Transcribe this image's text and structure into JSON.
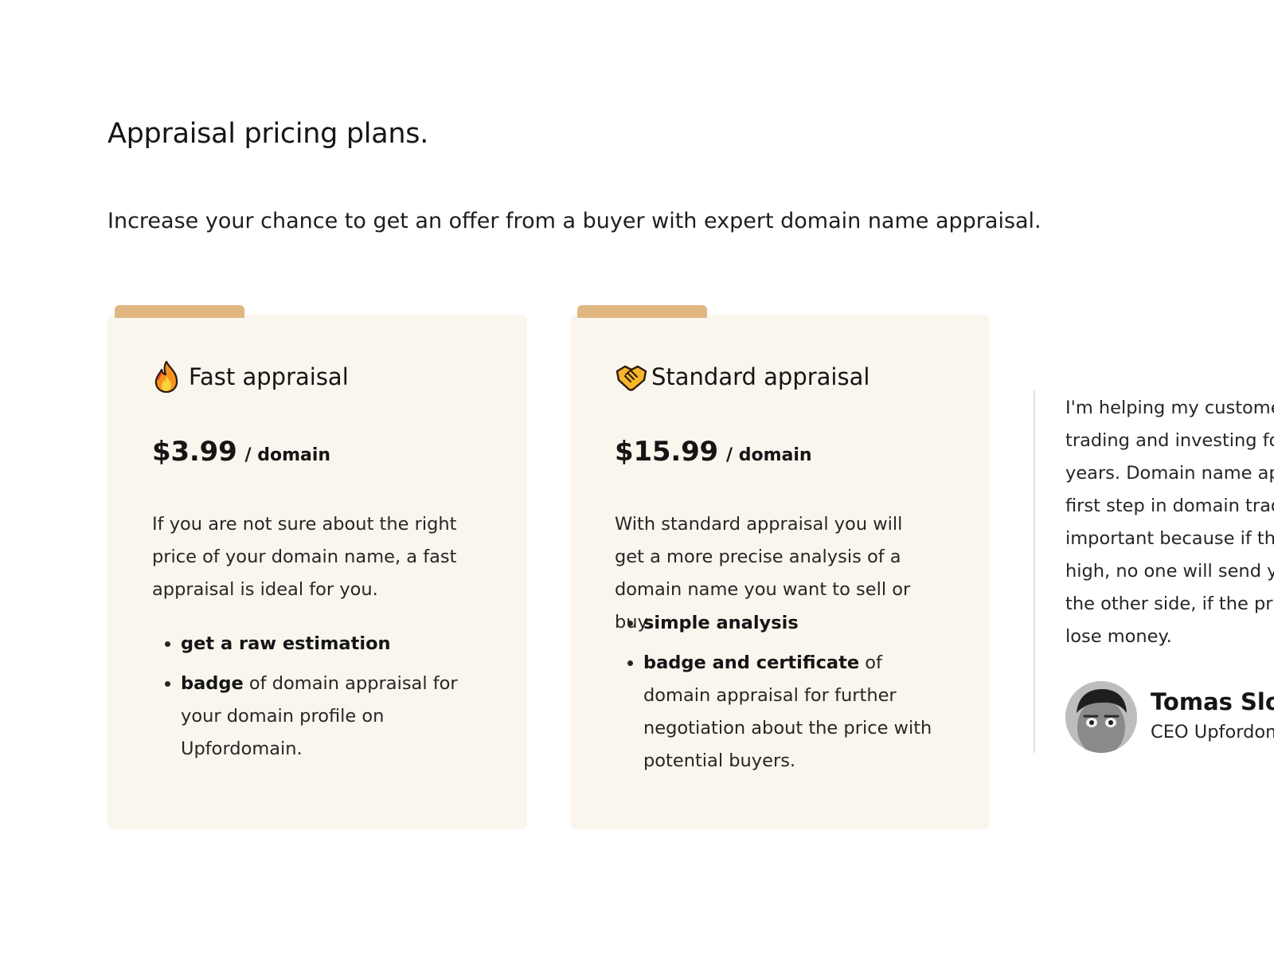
{
  "section": {
    "title": "Appraisal pricing plans.",
    "subtitle": "Increase your chance to get an offer from a buyer with expert domain name appraisal."
  },
  "plans": [
    {
      "icon": "fire-icon",
      "title": "Fast appraisal",
      "price": "$3.99",
      "unit": "/ domain",
      "description": "If you are not sure about the right price of your domain name, a fast appraisal is ideal for you.",
      "features": [
        {
          "strong": "get a raw estimation",
          "rest": ""
        },
        {
          "strong": "badge",
          "rest": " of domain appraisal for your domain profile on Upfordomain."
        }
      ]
    },
    {
      "icon": "handshake-icon",
      "title": "Standard appraisal",
      "price": "$15.99",
      "unit": "/ domain",
      "description": "With standard appraisal you will get a more precise analysis of a domain name you want to sell or buy:",
      "features": [
        {
          "strong": "simple analysis",
          "rest": ""
        },
        {
          "strong": "badge and certificate",
          "rest": " of domain appraisal for further negotiation about the price with potential buyers."
        }
      ]
    }
  ],
  "testimonial": {
    "quote_lines": [
      "I'm helping my customer",
      "trading and investing for",
      "years. Domain name app",
      "first step in domain tradi",
      "important because if the",
      "high, no one will send yo",
      "the other side, if the pric",
      "lose money."
    ],
    "author_name": "Tomas Slou",
    "author_role": "CEO Upfordom"
  },
  "colors": {
    "card_background": "#faf6ed",
    "card_tab": "#e0b781",
    "testimonial_border": "#dbe6d3"
  }
}
